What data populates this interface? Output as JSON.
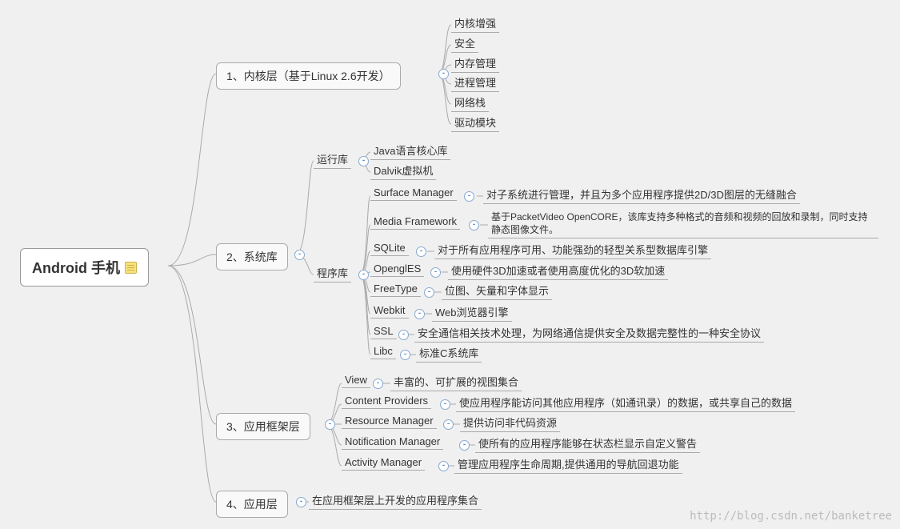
{
  "root": {
    "title": "Android 手机"
  },
  "branches": [
    {
      "label": "1、内核层（基于Linux 2.6开发）",
      "children": [
        {
          "label": "内核增强"
        },
        {
          "label": "安全"
        },
        {
          "label": "内存管理"
        },
        {
          "label": "进程管理"
        },
        {
          "label": "网络栈"
        },
        {
          "label": "驱动模块"
        }
      ]
    },
    {
      "label": "2、系统库",
      "groups": [
        {
          "label": "运行库",
          "children": [
            {
              "label": "Java语言核心库"
            },
            {
              "label": "Dalvik虚拟机"
            }
          ]
        },
        {
          "label": "程序库",
          "children": [
            {
              "label": "Surface Manager",
              "desc": "对子系统进行管理，并且为多个应用程序提供2D/3D图层的无缝融合"
            },
            {
              "label": "Media Framework",
              "desc": "基于PacketVideo OpenCORE，该库支持多种格式的音频和视频的回放和录制，同时支持静态图像文件。"
            },
            {
              "label": "SQLite",
              "desc": "对于所有应用程序可用、功能强劲的轻型关系型数据库引擎"
            },
            {
              "label": "OpenglES",
              "desc": "使用硬件3D加速或者使用高度优化的3D软加速"
            },
            {
              "label": "FreeType",
              "desc": "位图、矢量和字体显示"
            },
            {
              "label": "Webkit",
              "desc": "Web浏览器引擎"
            },
            {
              "label": "SSL",
              "desc": "安全通信相关技术处理，为网络通信提供安全及数据完整性的一种安全协议"
            },
            {
              "label": "Libc",
              "desc": "标准C系统库"
            }
          ]
        }
      ]
    },
    {
      "label": "3、应用框架层",
      "children": [
        {
          "label": "View",
          "desc": "丰富的、可扩展的视图集合"
        },
        {
          "label": "Content Providers",
          "desc": "使应用程序能访问其他应用程序（如通讯录）的数据，或共享自己的数据"
        },
        {
          "label": "Resource Manager",
          "desc": "提供访问非代码资源"
        },
        {
          "label": "Notification Manager",
          "desc": "使所有的应用程序能够在状态栏显示自定义警告"
        },
        {
          "label": "Activity Manager",
          "desc": "管理应用程序生命周期,提供通用的导航回退功能"
        }
      ]
    },
    {
      "label": "4、应用层",
      "desc": "在应用框架层上开发的应用程序集合"
    }
  ],
  "watermark": "http://blog.csdn.net/banketree"
}
